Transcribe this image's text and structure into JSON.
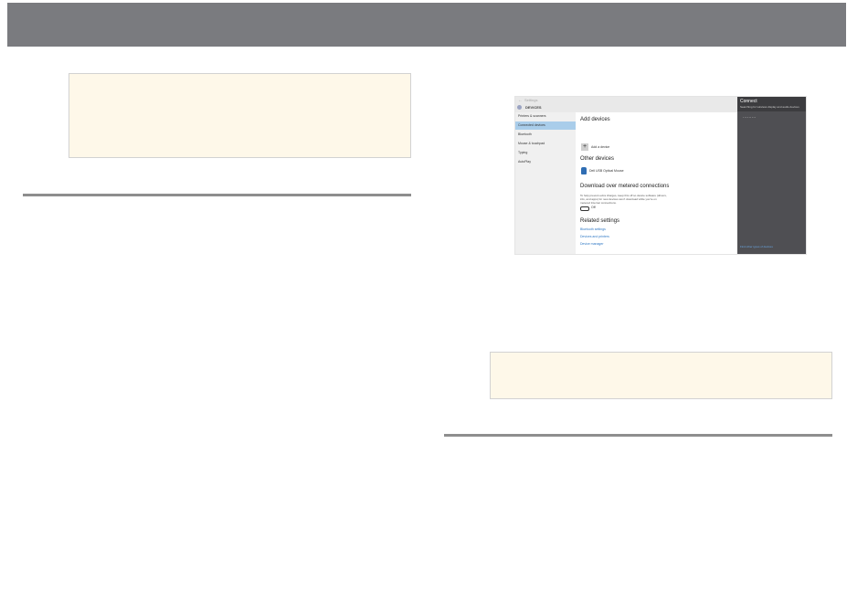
{
  "window": {
    "back_glyph": "←",
    "app_title": "Settings",
    "page_title": "DEVICES"
  },
  "sidebar": {
    "items": [
      {
        "label": "Printers & scanners"
      },
      {
        "label": "Connected devices"
      },
      {
        "label": "Bluetooth"
      },
      {
        "label": "Mouse & touchpad"
      },
      {
        "label": "Typing"
      },
      {
        "label": "AutoPlay"
      }
    ],
    "active_index": 1
  },
  "main": {
    "add_devices_heading": "Add devices",
    "add_device_label": "Add a device",
    "other_devices_heading": "Other devices",
    "mouse_device_label": "Dell USB Optical Mouse",
    "metered_heading": "Download over metered connections",
    "metered_text": "To help prevent extra charges, keep this off so device software (drivers, info, and apps) for new devices won't download while you're on metered Internet connections.",
    "toggle_label": "Off",
    "related_heading": "Related settings",
    "related_links": [
      "Bluetooth settings",
      "Devices and printers",
      "Device manager"
    ]
  },
  "connect_panel": {
    "title": "Connect",
    "subtitle": "Searching for wireless display and audio devices",
    "progress_dots": "·········",
    "footer_link": "Find other types of devices"
  },
  "colors": {
    "header_bar": "#7a7b7f",
    "note_fill": "#fef8e9",
    "rule": "#8e8e8e",
    "active_nav": "#a9cdea",
    "link": "#2f78c4",
    "panel": "#4f4f53"
  }
}
